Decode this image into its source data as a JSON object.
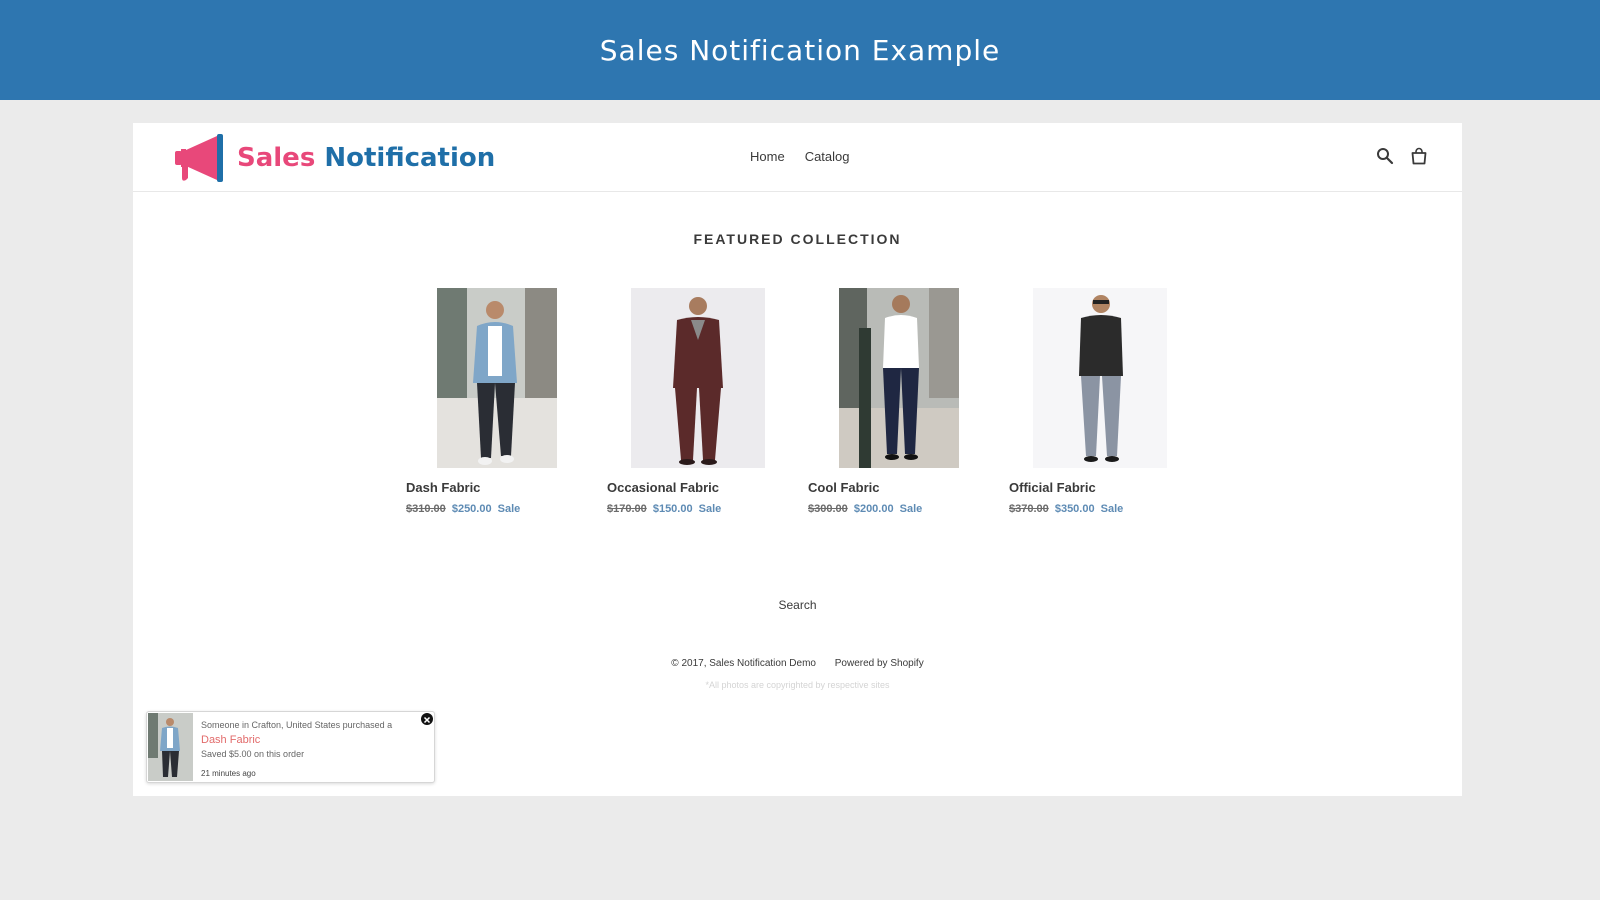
{
  "banner": {
    "title": "Sales Notification Example"
  },
  "header": {
    "logo_word1": "Sales",
    "logo_word2": "Notification",
    "nav": [
      {
        "label": "Home"
      },
      {
        "label": "Catalog"
      }
    ],
    "icons": [
      "search-icon",
      "cart-icon"
    ]
  },
  "main": {
    "section_title": "FEATURED COLLECTION",
    "products": [
      {
        "title": "Dash Fabric",
        "old_price": "$310.00",
        "price": "$250.00",
        "badge": "Sale"
      },
      {
        "title": "Occasional Fabric",
        "old_price": "$170.00",
        "price": "$150.00",
        "badge": "Sale"
      },
      {
        "title": "Cool Fabric",
        "old_price": "$300.00",
        "price": "$200.00",
        "badge": "Sale"
      },
      {
        "title": "Official Fabric",
        "old_price": "$370.00",
        "price": "$350.00",
        "badge": "Sale"
      }
    ]
  },
  "footer": {
    "search_link": "Search",
    "copyright": "© 2017, Sales Notification Demo",
    "powered": "Powered by Shopify",
    "note": "*All photos are copyrighted by respective sites"
  },
  "notification": {
    "line1": "Someone in Crafton, United States purchased a",
    "product": "Dash Fabric",
    "saved": "Saved $5.00 on this order",
    "time": "21 minutes ago"
  },
  "colors": {
    "banner": "#2e76b0",
    "logo_pink": "#e8487a",
    "logo_blue": "#1f6fa8",
    "sale_price": "#5e8bb4",
    "notification_product": "#e26b6b"
  }
}
